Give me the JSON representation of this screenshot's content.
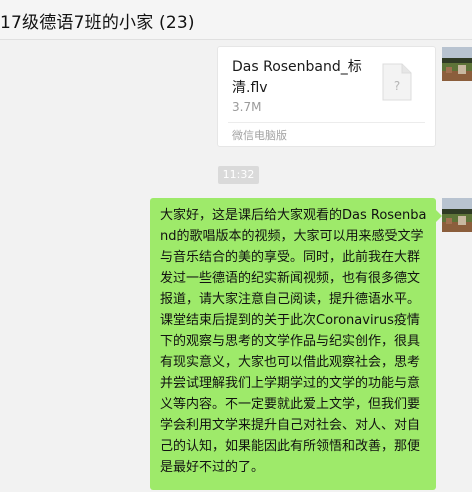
{
  "chat": {
    "title": "17级德语7班的小家 (23)"
  },
  "file_message": {
    "file_name": "Das Rosenband_标清.flv",
    "file_size": "3.7M",
    "source": "微信电脑版",
    "icon": "file-unknown-icon"
  },
  "timestamp": "11:32",
  "text_message": {
    "text": "大家好，这是课后给大家观看的Das Rosenband的歌唱版本的视频，大家可以用来感受文学与音乐结合的美的享受。同时，此前我在大群发过一些德语的纪实新闻视频，也有很多德文报道，请大家注意自己阅读，提升德语水平。课堂结束后提到的关于此次Coronavirus疫情下的观察与思考的文学作品与纪实创作，很具有现实意义，大家也可以借此观察社会，思考并尝试理解我们上学期学过的文学的功能与意义等内容。不一定要就此爱上文学，但我们要学会利用文学来提升自己对社会、对人、对自己的认知，如果能因此有所领悟和改善，那便是最好不过的了。"
  },
  "colors": {
    "background": "#f2f2f2",
    "bubble_green": "#9eea6a",
    "card_white": "#ffffff",
    "timestamp_bg": "#dadada",
    "muted_text": "#9a9a9a"
  }
}
